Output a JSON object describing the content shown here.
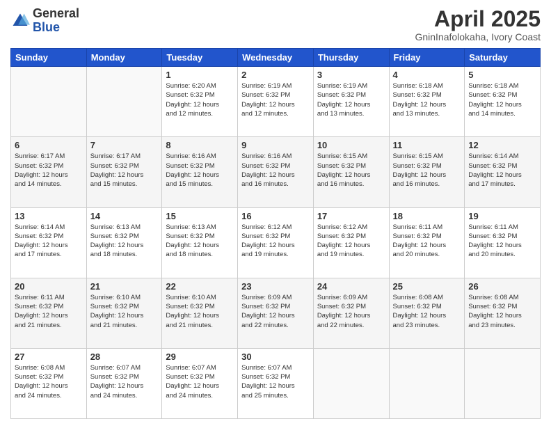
{
  "logo": {
    "general": "General",
    "blue": "Blue"
  },
  "header": {
    "title": "April 2025",
    "location": "GninInafolokaha, Ivory Coast"
  },
  "weekdays": [
    "Sunday",
    "Monday",
    "Tuesday",
    "Wednesday",
    "Thursday",
    "Friday",
    "Saturday"
  ],
  "weeks": [
    [
      {
        "day": "",
        "info": ""
      },
      {
        "day": "",
        "info": ""
      },
      {
        "day": "1",
        "info": "Sunrise: 6:20 AM\nSunset: 6:32 PM\nDaylight: 12 hours\nand 12 minutes."
      },
      {
        "day": "2",
        "info": "Sunrise: 6:19 AM\nSunset: 6:32 PM\nDaylight: 12 hours\nand 12 minutes."
      },
      {
        "day": "3",
        "info": "Sunrise: 6:19 AM\nSunset: 6:32 PM\nDaylight: 12 hours\nand 13 minutes."
      },
      {
        "day": "4",
        "info": "Sunrise: 6:18 AM\nSunset: 6:32 PM\nDaylight: 12 hours\nand 13 minutes."
      },
      {
        "day": "5",
        "info": "Sunrise: 6:18 AM\nSunset: 6:32 PM\nDaylight: 12 hours\nand 14 minutes."
      }
    ],
    [
      {
        "day": "6",
        "info": "Sunrise: 6:17 AM\nSunset: 6:32 PM\nDaylight: 12 hours\nand 14 minutes."
      },
      {
        "day": "7",
        "info": "Sunrise: 6:17 AM\nSunset: 6:32 PM\nDaylight: 12 hours\nand 15 minutes."
      },
      {
        "day": "8",
        "info": "Sunrise: 6:16 AM\nSunset: 6:32 PM\nDaylight: 12 hours\nand 15 minutes."
      },
      {
        "day": "9",
        "info": "Sunrise: 6:16 AM\nSunset: 6:32 PM\nDaylight: 12 hours\nand 16 minutes."
      },
      {
        "day": "10",
        "info": "Sunrise: 6:15 AM\nSunset: 6:32 PM\nDaylight: 12 hours\nand 16 minutes."
      },
      {
        "day": "11",
        "info": "Sunrise: 6:15 AM\nSunset: 6:32 PM\nDaylight: 12 hours\nand 16 minutes."
      },
      {
        "day": "12",
        "info": "Sunrise: 6:14 AM\nSunset: 6:32 PM\nDaylight: 12 hours\nand 17 minutes."
      }
    ],
    [
      {
        "day": "13",
        "info": "Sunrise: 6:14 AM\nSunset: 6:32 PM\nDaylight: 12 hours\nand 17 minutes."
      },
      {
        "day": "14",
        "info": "Sunrise: 6:13 AM\nSunset: 6:32 PM\nDaylight: 12 hours\nand 18 minutes."
      },
      {
        "day": "15",
        "info": "Sunrise: 6:13 AM\nSunset: 6:32 PM\nDaylight: 12 hours\nand 18 minutes."
      },
      {
        "day": "16",
        "info": "Sunrise: 6:12 AM\nSunset: 6:32 PM\nDaylight: 12 hours\nand 19 minutes."
      },
      {
        "day": "17",
        "info": "Sunrise: 6:12 AM\nSunset: 6:32 PM\nDaylight: 12 hours\nand 19 minutes."
      },
      {
        "day": "18",
        "info": "Sunrise: 6:11 AM\nSunset: 6:32 PM\nDaylight: 12 hours\nand 20 minutes."
      },
      {
        "day": "19",
        "info": "Sunrise: 6:11 AM\nSunset: 6:32 PM\nDaylight: 12 hours\nand 20 minutes."
      }
    ],
    [
      {
        "day": "20",
        "info": "Sunrise: 6:11 AM\nSunset: 6:32 PM\nDaylight: 12 hours\nand 21 minutes."
      },
      {
        "day": "21",
        "info": "Sunrise: 6:10 AM\nSunset: 6:32 PM\nDaylight: 12 hours\nand 21 minutes."
      },
      {
        "day": "22",
        "info": "Sunrise: 6:10 AM\nSunset: 6:32 PM\nDaylight: 12 hours\nand 21 minutes."
      },
      {
        "day": "23",
        "info": "Sunrise: 6:09 AM\nSunset: 6:32 PM\nDaylight: 12 hours\nand 22 minutes."
      },
      {
        "day": "24",
        "info": "Sunrise: 6:09 AM\nSunset: 6:32 PM\nDaylight: 12 hours\nand 22 minutes."
      },
      {
        "day": "25",
        "info": "Sunrise: 6:08 AM\nSunset: 6:32 PM\nDaylight: 12 hours\nand 23 minutes."
      },
      {
        "day": "26",
        "info": "Sunrise: 6:08 AM\nSunset: 6:32 PM\nDaylight: 12 hours\nand 23 minutes."
      }
    ],
    [
      {
        "day": "27",
        "info": "Sunrise: 6:08 AM\nSunset: 6:32 PM\nDaylight: 12 hours\nand 24 minutes."
      },
      {
        "day": "28",
        "info": "Sunrise: 6:07 AM\nSunset: 6:32 PM\nDaylight: 12 hours\nand 24 minutes."
      },
      {
        "day": "29",
        "info": "Sunrise: 6:07 AM\nSunset: 6:32 PM\nDaylight: 12 hours\nand 24 minutes."
      },
      {
        "day": "30",
        "info": "Sunrise: 6:07 AM\nSunset: 6:32 PM\nDaylight: 12 hours\nand 25 minutes."
      },
      {
        "day": "",
        "info": ""
      },
      {
        "day": "",
        "info": ""
      },
      {
        "day": "",
        "info": ""
      }
    ]
  ]
}
